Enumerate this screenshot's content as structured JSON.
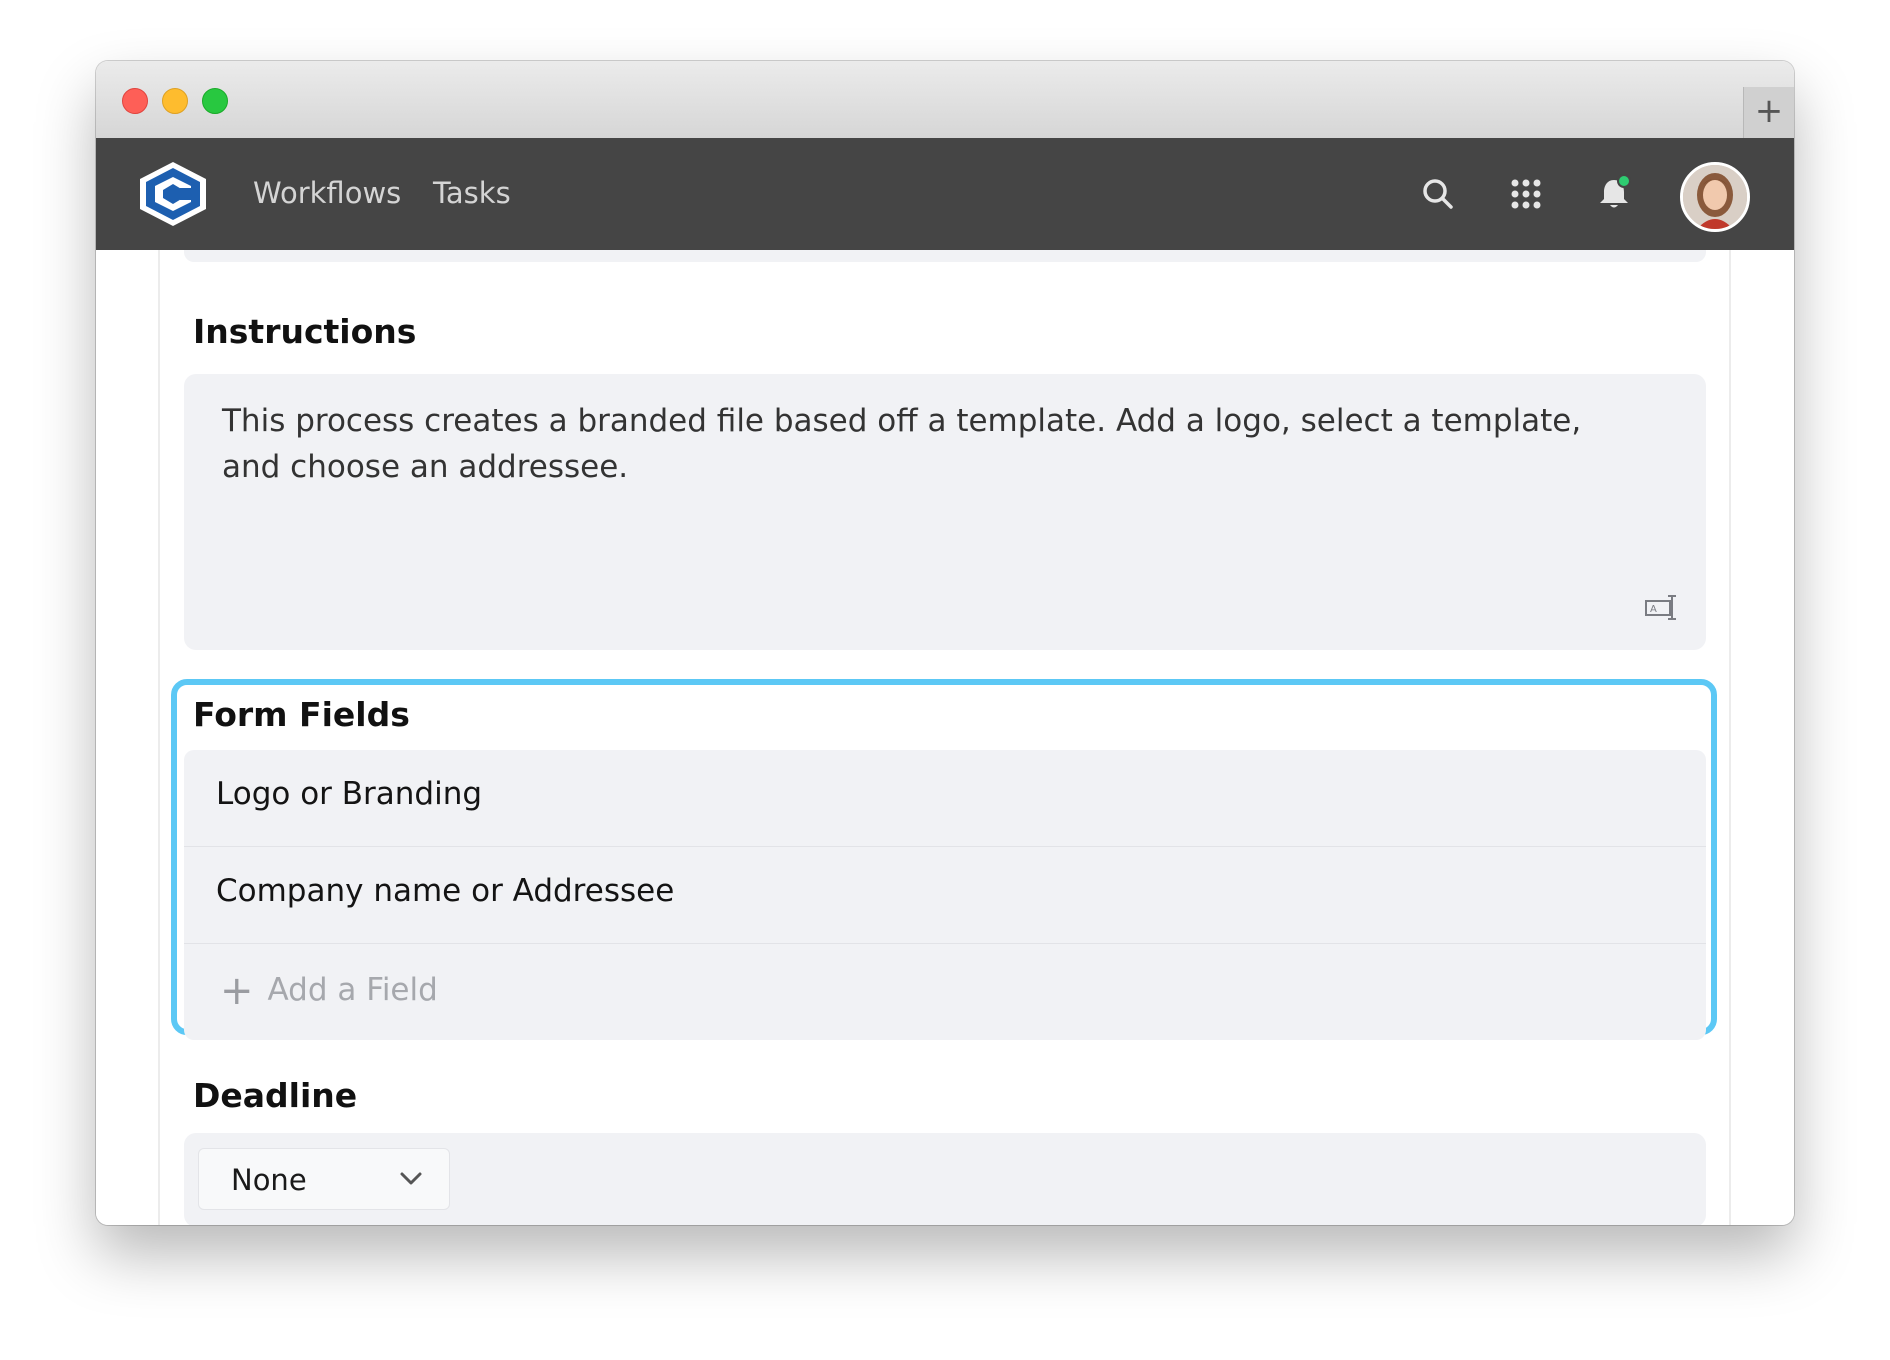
{
  "window": {
    "new_tab_label": "+"
  },
  "navbar": {
    "links": [
      {
        "label": "Workflows"
      },
      {
        "label": "Tasks"
      }
    ],
    "icons": [
      "search-icon",
      "apps-grid-icon",
      "bell-icon",
      "avatar"
    ],
    "notification_dot_color": "#2ecc71"
  },
  "instructions": {
    "title": "Instructions",
    "text": "This process creates a branded file based off a template. Add a logo, select a template, and choose an addressee."
  },
  "form_fields": {
    "title": "Form Fields",
    "fields": [
      {
        "label": "Logo or Branding"
      },
      {
        "label": "Company name or Addressee"
      }
    ],
    "add_label": "Add a Field",
    "highlight_color": "#5cc8f5"
  },
  "deadline": {
    "title": "Deadline",
    "selected": "None"
  },
  "colors": {
    "navbar": "#454545",
    "card": "#f1f2f5",
    "accent": "#5cc8f5"
  }
}
